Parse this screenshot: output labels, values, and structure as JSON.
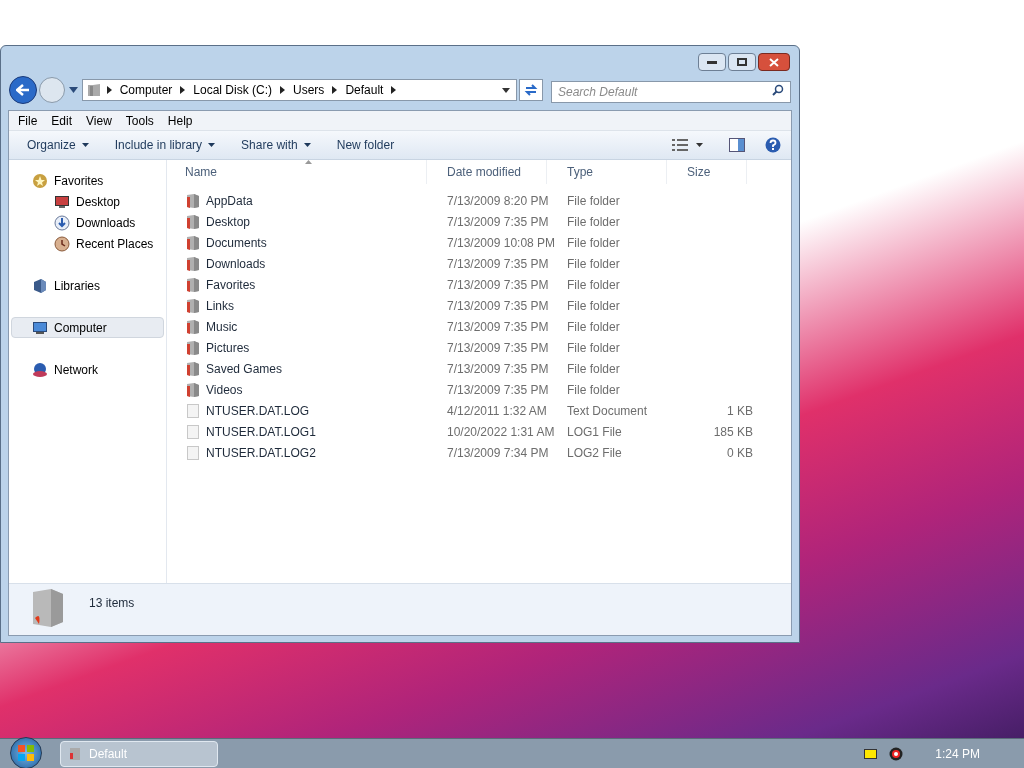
{
  "address": {
    "crumbs": [
      "Computer",
      "Local Disk (C:)",
      "Users",
      "Default"
    ]
  },
  "search": {
    "placeholder": "Search Default"
  },
  "menu": [
    "File",
    "Edit",
    "View",
    "Tools",
    "Help"
  ],
  "toolbar": [
    {
      "label": "Organize",
      "dropdown": true
    },
    {
      "label": "Include in library",
      "dropdown": true
    },
    {
      "label": "Share with",
      "dropdown": true
    },
    {
      "label": "New folder",
      "dropdown": false
    }
  ],
  "nav": [
    {
      "label": "Favorites",
      "kind": "star",
      "selected": false,
      "children": [
        {
          "label": "Desktop",
          "kind": "desktop",
          "selected": false
        },
        {
          "label": "Downloads",
          "kind": "download",
          "selected": false
        },
        {
          "label": "Recent Places",
          "kind": "recent",
          "selected": false
        }
      ]
    },
    {
      "label": "Libraries",
      "kind": "library",
      "selected": false
    },
    {
      "label": "Computer",
      "kind": "computer",
      "selected": true
    },
    {
      "label": "Network",
      "kind": "network",
      "selected": false
    }
  ],
  "table": {
    "columns": [
      "Name",
      "Date modified",
      "Type",
      "Size"
    ],
    "rows": [
      {
        "kind": "folder",
        "name": "AppData",
        "date": "7/13/2009 8:20 PM",
        "type": "File folder"
      },
      {
        "kind": "folder",
        "name": "Desktop",
        "date": "7/13/2009 7:35 PM",
        "type": "File folder"
      },
      {
        "kind": "folder",
        "name": "Documents",
        "date": "7/13/2009 10:08 PM",
        "type": "File folder"
      },
      {
        "kind": "folder",
        "name": "Downloads",
        "date": "7/13/2009 7:35 PM",
        "type": "File folder"
      },
      {
        "kind": "folder",
        "name": "Favorites",
        "date": "7/13/2009 7:35 PM",
        "type": "File folder"
      },
      {
        "kind": "folder",
        "name": "Links",
        "date": "7/13/2009 7:35 PM",
        "type": "File folder"
      },
      {
        "kind": "folder",
        "name": "Music",
        "date": "7/13/2009 7:35 PM",
        "type": "File folder"
      },
      {
        "kind": "folder",
        "name": "Pictures",
        "date": "7/13/2009 7:35 PM",
        "type": "File folder"
      },
      {
        "kind": "folder",
        "name": "Saved Games",
        "date": "7/13/2009 7:35 PM",
        "type": "File folder"
      },
      {
        "kind": "folder",
        "name": "Videos",
        "date": "7/13/2009 7:35 PM",
        "type": "File folder"
      },
      {
        "kind": "file",
        "name": "NTUSER.DAT.LOG",
        "date": "4/12/2011 1:32 AM",
        "type": "Text Document",
        "size": "1 KB"
      },
      {
        "kind": "file",
        "name": "NTUSER.DAT.LOG1",
        "date": "10/20/2022 1:31 AM",
        "type": "LOG1 File",
        "size": "185 KB"
      },
      {
        "kind": "file",
        "name": "NTUSER.DAT.LOG2",
        "date": "7/13/2009 7:34 PM",
        "type": "LOG2 File",
        "size": "0 KB"
      }
    ]
  },
  "status": {
    "count": "13 items"
  },
  "taskbar": {
    "task": "Default",
    "clock": "1:24 PM"
  }
}
